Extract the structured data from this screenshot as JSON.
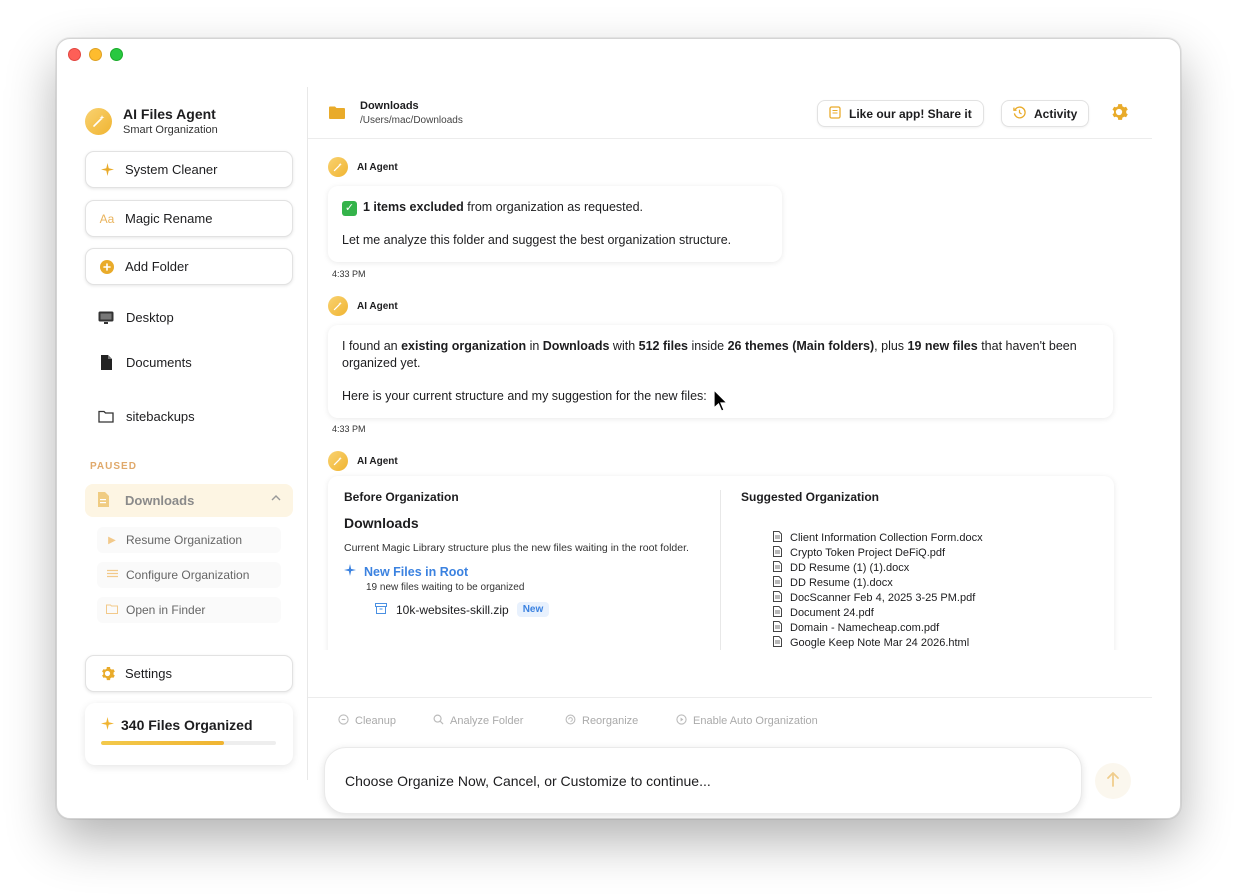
{
  "sidebar": {
    "app_title": "AI Files Agent",
    "app_subtitle": "Smart Organization",
    "actions": {
      "system_cleaner": "System Cleaner",
      "magic_rename": "Magic Rename",
      "magic_rename_icon_text": "Aa",
      "add_folder": "Add Folder"
    },
    "locations": {
      "desktop": "Desktop",
      "documents": "Documents",
      "sitebackups": "sitebackups"
    },
    "paused_label": "PAUSED",
    "active_folder": "Downloads",
    "folder_actions": {
      "resume": "Resume Organization",
      "configure": "Configure Organization",
      "open_finder": "Open in Finder"
    },
    "settings": "Settings",
    "files_organized": "340 Files Organized",
    "files_progress": 0.7
  },
  "header": {
    "folder_name": "Downloads",
    "folder_path": "/Users/mac/Downloads",
    "share_button": "Like our app! Share it",
    "activity_button": "Activity"
  },
  "chat": {
    "agent_name": "AI Agent",
    "messages": [
      {
        "check": "✓",
        "bold_a": "1 items excluded",
        "text_a": " from organization as requested.",
        "paragraph_2": "Let me analyze this folder and suggest the best organization structure.",
        "time": "4:33 PM"
      },
      {
        "p1_a": "I found an ",
        "p1_b": "existing organization",
        "p1_c": " in ",
        "p1_d": "Downloads",
        "p1_e": " with ",
        "p1_f": "512 files",
        "p1_g": " inside ",
        "p1_h": "26 themes (Main folders)",
        "p1_i": ", plus ",
        "p1_j": "19 new files",
        "p1_k": " that haven't been organized yet.",
        "paragraph_2": "Here is your current structure and my suggestion for the new files:",
        "time": "4:33 PM"
      }
    ],
    "organization": {
      "before_title": "Before Organization",
      "folder": "Downloads",
      "description": "Current Magic Library structure plus the new files waiting in the root folder.",
      "new_files_title": "New Files in Root",
      "new_files_sub": "19 new files waiting to be organized",
      "files": [
        {
          "name": "10k-websites-skill.zip",
          "badge": "New"
        }
      ],
      "suggested_title": "Suggested Organization",
      "suggested_files": [
        "Client Information Collection Form.docx",
        "Crypto Token Project DeFiQ.pdf",
        "DD Resume (1) (1).docx",
        "DD Resume (1).docx",
        "DocScanner Feb 4, 2025 3-25 PM.pdf",
        "Document 24.pdf",
        "Domain - Namecheap.com.pdf",
        "Google Keep Note Mar 24 2026.html"
      ]
    }
  },
  "toolbar": {
    "cleanup": "Cleanup",
    "analyze": "Analyze Folder",
    "reorganize": "Reorganize",
    "auto": "Enable Auto Organization"
  },
  "input": {
    "prompt_text": "Choose Organize Now, Cancel, or Customize to continue..."
  },
  "colors": {
    "accent": "#f0b431",
    "link_blue": "#3b82e0",
    "paused": "#e0a96b"
  }
}
